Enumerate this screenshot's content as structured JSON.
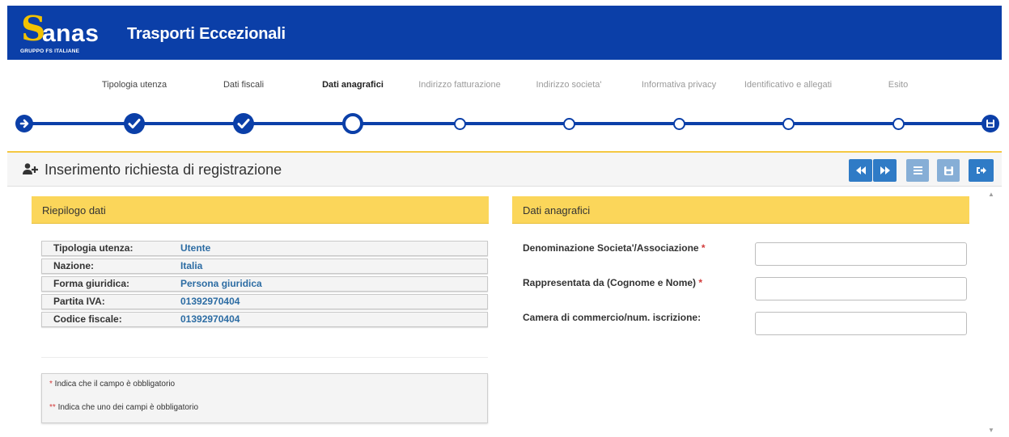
{
  "header": {
    "logo_word": "anas",
    "logo_subtitle": "GRUPPO FS ITALIANE",
    "app_title": "Trasporti Eccezionali"
  },
  "stepper": {
    "steps": [
      {
        "label": "Tipologia utenza",
        "state": "done"
      },
      {
        "label": "Dati fiscali",
        "state": "done"
      },
      {
        "label": "Dati anagrafici",
        "state": "active"
      },
      {
        "label": "Indirizzo fatturazione",
        "state": "pending"
      },
      {
        "label": "Indirizzo societa'",
        "state": "pending"
      },
      {
        "label": "Informativa privacy",
        "state": "pending"
      },
      {
        "label": "Identificativo e allegati",
        "state": "pending"
      },
      {
        "label": "Esito",
        "state": "pending"
      }
    ]
  },
  "panel": {
    "title": "Inserimento richiesta di registrazione",
    "toolbar": {
      "first_icon": "fast-backward-icon",
      "next_icon": "fast-forward-icon",
      "list_icon": "list-icon",
      "save_icon": "floppy-disk-icon",
      "exit_icon": "sign-out-icon"
    }
  },
  "summary": {
    "title": "Riepilogo dati",
    "rows": [
      {
        "label": "Tipologia utenza:",
        "value": "Utente"
      },
      {
        "label": "Nazione:",
        "value": "Italia"
      },
      {
        "label": "Forma giuridica:",
        "value": "Persona giuridica"
      },
      {
        "label": "Partita IVA:",
        "value": "01392970404"
      },
      {
        "label": "Codice fiscale:",
        "value": "01392970404"
      }
    ],
    "legend": {
      "single_marker": "*",
      "single_text": " Indica che il campo è obbligatorio",
      "double_marker": "**",
      "double_text": " Indica che uno dei campi è obbligatorio"
    }
  },
  "form": {
    "title": "Dati anagrafici",
    "fields": [
      {
        "label": "Denominazione Societa'/Associazione",
        "required": "*",
        "value": ""
      },
      {
        "label": "Rappresentata da (Cognome e Nome)",
        "required": "*",
        "value": ""
      },
      {
        "label": "Camera di commercio/num. iscrizione:",
        "required": "",
        "value": ""
      }
    ]
  },
  "colors": {
    "brand_blue": "#0b3fa8",
    "accent_yellow": "#fbd65a",
    "button_blue": "#2f7bc6",
    "value_blue": "#2c6ca3",
    "required_red": "#d23a3a"
  }
}
